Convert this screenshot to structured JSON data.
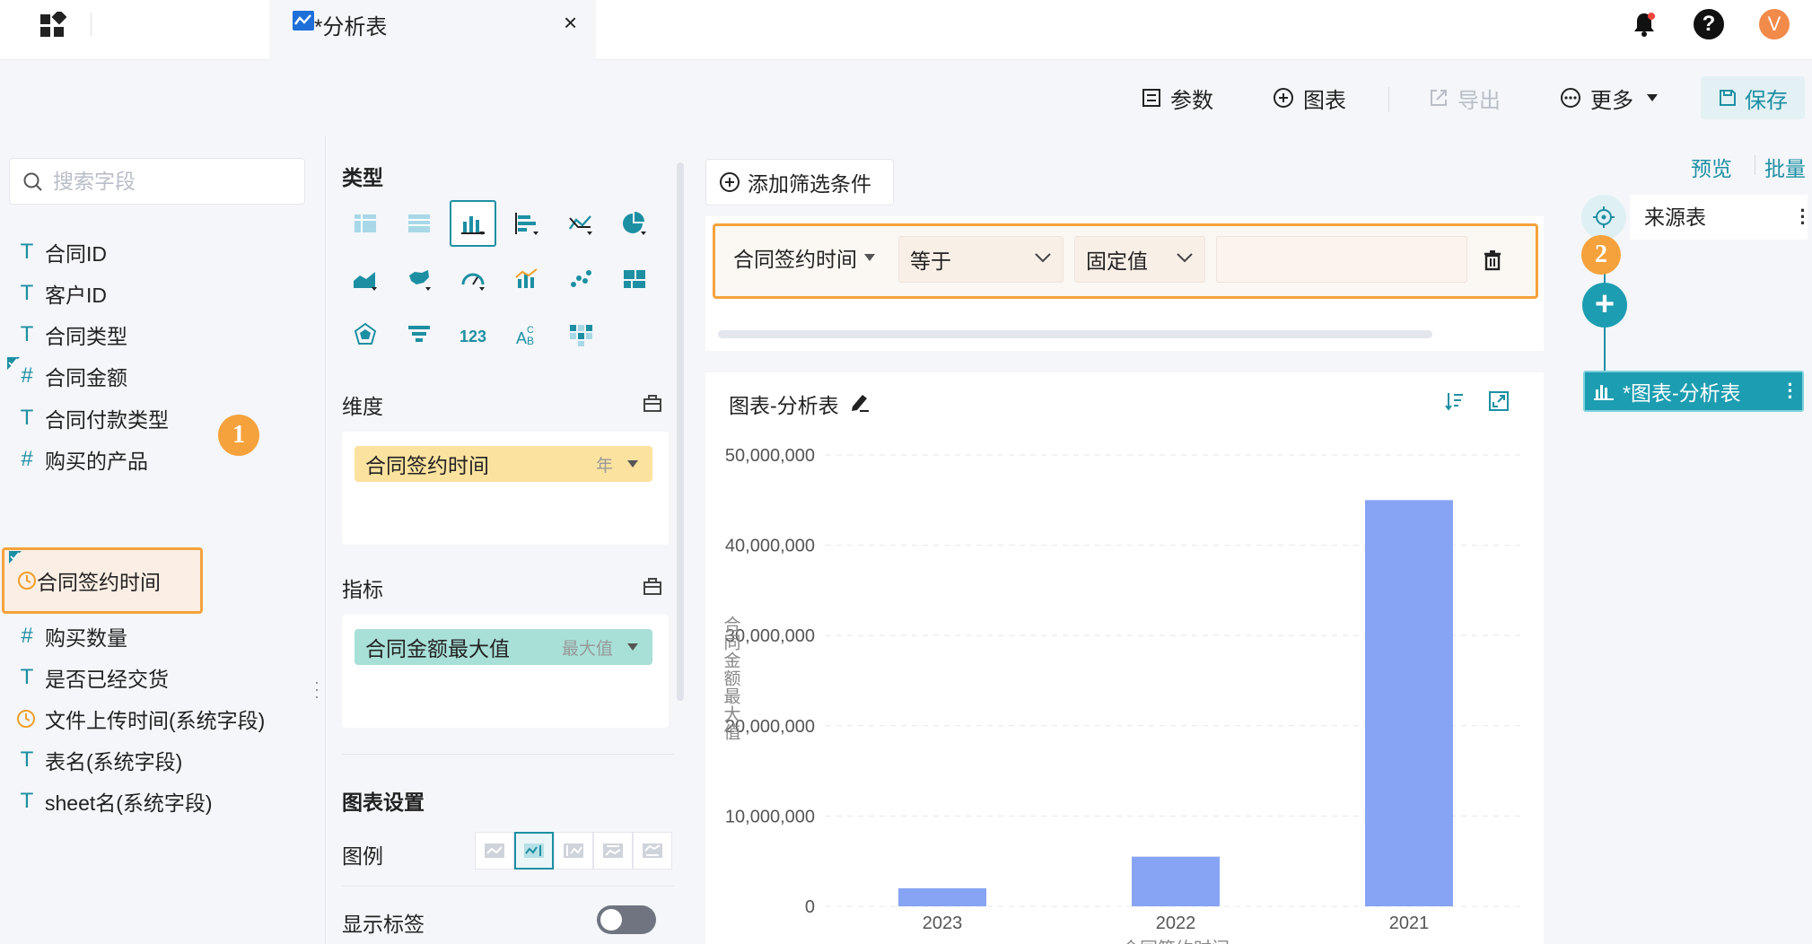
{
  "header": {
    "tab_title": "*分析表",
    "tab_close": "×",
    "help": "?",
    "avatar_letter": "V"
  },
  "toolbar": {
    "params": "参数",
    "chart": "图表",
    "export": "导出",
    "more": "更多",
    "save": "保存"
  },
  "fields": {
    "search_placeholder": "搜索字段",
    "items": [
      {
        "label": "合同ID",
        "icon": "T"
      },
      {
        "label": "客户ID",
        "icon": "T"
      },
      {
        "label": "合同类型",
        "icon": "T"
      },
      {
        "label": "合同金额",
        "icon": "#"
      },
      {
        "label": "合同付款类型",
        "icon": "T"
      },
      {
        "label": "购买的产品",
        "icon": "#"
      },
      {
        "label": "合同签约时间",
        "icon": "clock"
      },
      {
        "label": "购买数量",
        "icon": "#"
      },
      {
        "label": "是否已经交货",
        "icon": "T"
      },
      {
        "label": "文件上传时间(系统字段)",
        "icon": "clock"
      },
      {
        "label": "表名(系统字段)",
        "icon": "T"
      },
      {
        "label": "sheet名(系统字段)",
        "icon": "T"
      }
    ],
    "badge1": "1"
  },
  "config": {
    "type_title": "类型",
    "dimension_title": "维度",
    "dimension_pill": "合同签约时间",
    "dimension_agg": "年",
    "metric_title": "指标",
    "metric_pill": "合同金额最大值",
    "metric_agg": "最大值",
    "chart_settings_title": "图表设置",
    "legend_label": "图例",
    "show_label": "显示标签"
  },
  "filter": {
    "add_button": "添加筛选条件",
    "field": "合同签约时间",
    "operator": "等于",
    "value_type": "固定值",
    "value": "",
    "badge2": "2"
  },
  "chart_card": {
    "title": "图表-分析表"
  },
  "right_panel": {
    "preview": "预览",
    "batch": "批量",
    "source_node": "来源表",
    "chart_node": "*图表-分析表"
  },
  "colors": {
    "accent": "#1d8fa3",
    "highlight": "#f5a23c",
    "bar": "#87a4f4"
  },
  "chart_data": {
    "type": "bar",
    "categories": [
      "2023",
      "2022",
      "2021"
    ],
    "values": [
      2000000,
      5500000,
      45000000
    ],
    "xlabel": "合同签约时间",
    "ylabel": "合同金额最大值",
    "ylim": [
      0,
      50000000
    ],
    "yticks": [
      0,
      10000000,
      20000000,
      30000000,
      40000000,
      50000000
    ],
    "ytick_labels": [
      "0",
      "10,000,000",
      "20,000,000",
      "30,000,000",
      "40,000,000",
      "50,000,000"
    ],
    "grid": true,
    "legend": "none"
  }
}
